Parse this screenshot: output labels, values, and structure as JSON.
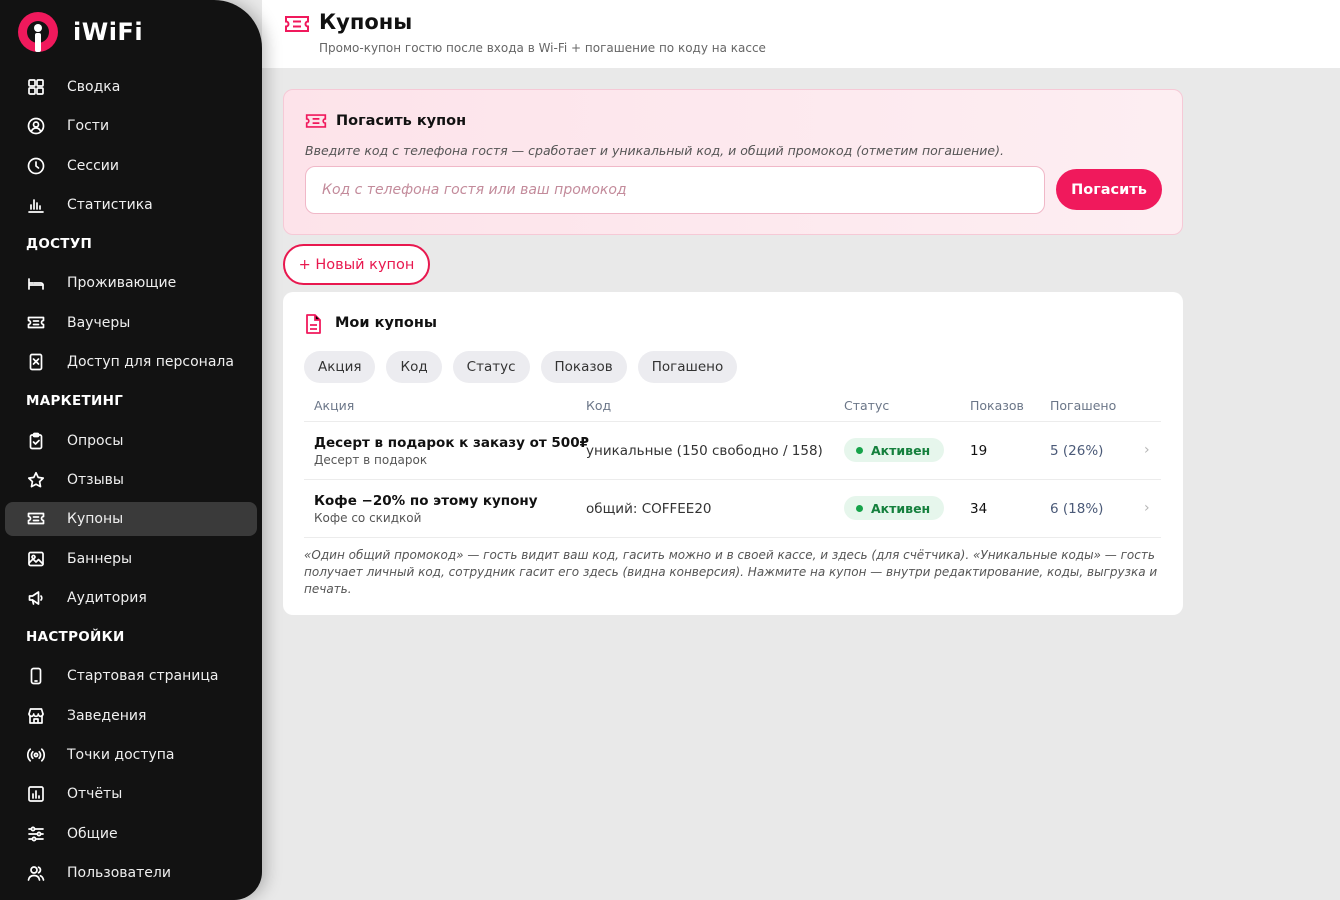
{
  "brand": {
    "name": "iWiFi",
    "accent": "#f0195c"
  },
  "sidebar": {
    "items": [
      {
        "type": "item",
        "label": "Сводка",
        "icon": "dashboard-icon"
      },
      {
        "type": "item",
        "label": "Гости",
        "icon": "user-circle-icon"
      },
      {
        "type": "item",
        "label": "Сессии",
        "icon": "clock-icon"
      },
      {
        "type": "item",
        "label": "Статистика",
        "icon": "bar-chart-icon"
      },
      {
        "type": "section",
        "label": "ДОСТУП"
      },
      {
        "type": "item",
        "label": "Проживающие",
        "icon": "bed-icon"
      },
      {
        "type": "item",
        "label": "Ваучеры",
        "icon": "ticket-icon"
      },
      {
        "type": "item",
        "label": "Доступ для персонала",
        "icon": "badge-icon"
      },
      {
        "type": "section",
        "label": "МАРКЕТИНГ"
      },
      {
        "type": "item",
        "label": "Опросы",
        "icon": "clipboard-icon"
      },
      {
        "type": "item",
        "label": "Отзывы",
        "icon": "star-icon"
      },
      {
        "type": "item",
        "label": "Купоны",
        "icon": "ticket-icon",
        "active": true
      },
      {
        "type": "item",
        "label": "Баннеры",
        "icon": "image-icon"
      },
      {
        "type": "item",
        "label": "Аудитория",
        "icon": "megaphone-icon"
      },
      {
        "type": "section",
        "label": "НАСТРОЙКИ"
      },
      {
        "type": "item",
        "label": "Стартовая страница",
        "icon": "phone-icon"
      },
      {
        "type": "item",
        "label": "Заведения",
        "icon": "store-icon"
      },
      {
        "type": "item",
        "label": "Точки доступа",
        "icon": "broadcast-icon"
      },
      {
        "type": "item",
        "label": "Отчёты",
        "icon": "report-icon"
      },
      {
        "type": "item",
        "label": "Общие",
        "icon": "sliders-icon"
      },
      {
        "type": "item",
        "label": "Пользователи",
        "icon": "users-icon"
      }
    ]
  },
  "header": {
    "title": "Купоны",
    "subtitle": "Промо-купон гостю после входа в Wi-Fi + погашение по коду на кассе"
  },
  "redeem": {
    "title": "Погасить купон",
    "hint": "Введите код с телефона гостя — сработает и уникальный код, и общий промокод (отметим погашение).",
    "placeholder": "Код с телефона гостя или ваш промокод",
    "value": "",
    "button": "Погасить"
  },
  "new_coupon_label": "+ Новый купон",
  "coupons": {
    "title": "Мои купоны",
    "chips": [
      "Акция",
      "Код",
      "Статус",
      "Показов",
      "Погашено"
    ],
    "columns": [
      "Акция",
      "Код",
      "Статус",
      "Показов",
      "Погашено"
    ],
    "rows": [
      {
        "name": "Десерт в подарок к заказу от 500₽",
        "sub": "Десерт в подарок",
        "code": "уникальные (150 свободно / 158)",
        "status": "Активен",
        "shows": "19",
        "redeemed": "5 (26%)"
      },
      {
        "name": "Кофе −20% по этому купону",
        "sub": "Кофе со скидкой",
        "code": "общий: COFFEE20",
        "status": "Активен",
        "shows": "34",
        "redeemed": "6 (18%)"
      }
    ],
    "footnote": "«Один общий промокод» — гость видит ваш код, гасить можно и в своей кассе, и здесь (для счётчика). «Уникальные коды» — гость получает личный код, сотрудник гасит его здесь (видна конверсия). Нажмите на купон — внутри редактирование, коды, выгрузка и печать."
  }
}
